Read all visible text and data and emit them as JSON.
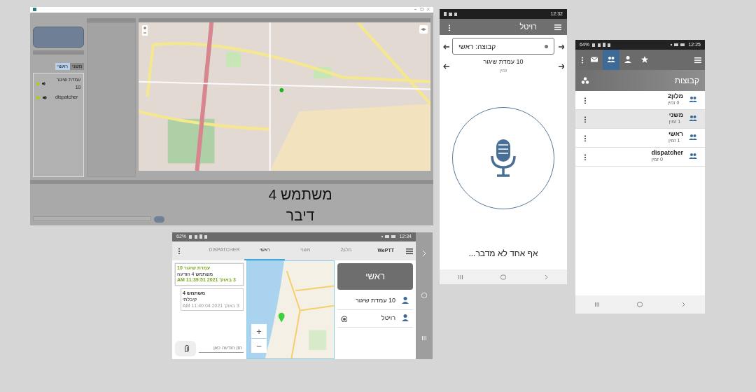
{
  "desktop": {
    "list_tabs": [
      {
        "label": "משני",
        "selected": false
      },
      {
        "label": "ראשי",
        "selected": true
      }
    ],
    "list_items": [
      {
        "name": "עמדת שיגור 10"
      },
      {
        "name": "dispatcher"
      }
    ],
    "speaker": {
      "name": "משתמש 4",
      "action": "דיבר"
    }
  },
  "phone_talk": {
    "time": "12:32",
    "title": "רויטל",
    "group": "קבוצה: ראשי",
    "member": "10 עמדת שיגור",
    "member_status": "זמין",
    "status_text": "אף אחד לא מדבר..."
  },
  "phone_groups": {
    "battery": "64%",
    "time": "12:25",
    "section": "קבוצות",
    "toolbar": [
      {
        "kind": "mail",
        "selected": false
      },
      {
        "kind": "group",
        "selected": true
      },
      {
        "kind": "person",
        "selected": false
      },
      {
        "kind": "star",
        "selected": false
      }
    ],
    "groups": [
      {
        "name": "מלון2",
        "count": "0 זמין",
        "selected": false
      },
      {
        "name": "משני",
        "count": "1 זמין",
        "selected": true
      },
      {
        "name": "ראשי",
        "count": "1 זמין",
        "selected": false
      },
      {
        "name": "dispatcher",
        "count": "0 זמין",
        "selected": false
      }
    ]
  },
  "tablet": {
    "battery": "62%",
    "time": "12:34",
    "app": "WePTT",
    "tabs": [
      {
        "label": "מלון2",
        "selected": false
      },
      {
        "label": "משני",
        "selected": false
      },
      {
        "label": "ראשי",
        "selected": true
      },
      {
        "label": "DISPATCHER",
        "selected": false
      }
    ],
    "group_button": "ראשי",
    "members": [
      {
        "name": "10 עמדת שיגור",
        "located": false
      },
      {
        "name": "רויטל",
        "located": true
      }
    ],
    "messages": [
      {
        "sender": "עמדת שיגור 10",
        "text": "משתמש 4 הודעה",
        "time": "3 באוק' 2021 11:39:51 AM",
        "outgoing": false
      },
      {
        "sender": "משתמש 4",
        "text": "קיבלתי",
        "time": "3 באוק' 2021 11:40:04 AM",
        "outgoing": true
      }
    ],
    "zoom": [
      "+",
      "−"
    ],
    "placeholder": "הזן הודעה כאן"
  }
}
